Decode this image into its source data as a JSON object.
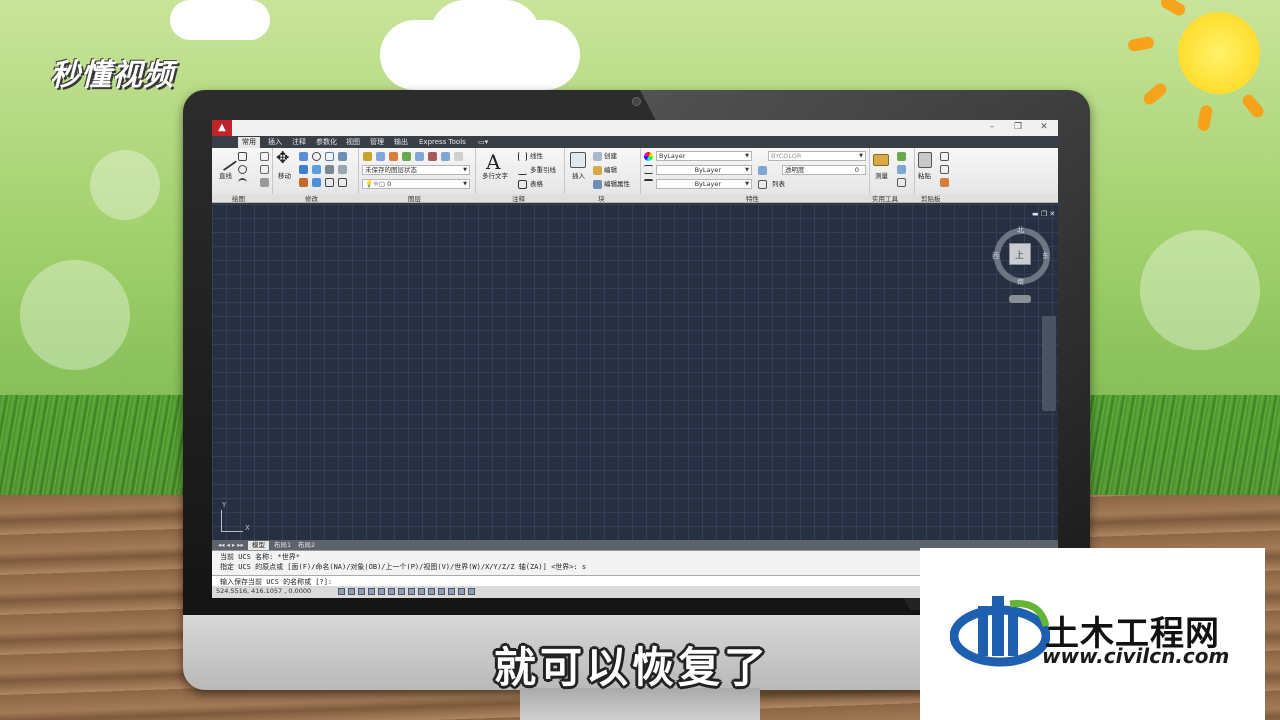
{
  "watermark_top": {
    "logo_text": "秒懂视频"
  },
  "watermark_bottom": {
    "name": "土木工程网",
    "url": "www.civilcn.com"
  },
  "subtitle": "就可以恢复了",
  "app": {
    "tabs": [
      "常用",
      "插入",
      "注释",
      "参数化",
      "视图",
      "管理",
      "输出",
      "Express Tools"
    ],
    "active_tab": "常用",
    "panels": {
      "draw": {
        "title": "绘图",
        "line_label": "直线"
      },
      "modify": {
        "title": "修改",
        "move_label": "移动"
      },
      "layers": {
        "title": "图层",
        "layer_state": "未保存的图层状态",
        "current_layer": "0"
      },
      "annotation": {
        "title": "注释",
        "mtext_label": "多行文字",
        "linear_label": "线性",
        "mleader_label": "多重引线",
        "table_label": "表格"
      },
      "block": {
        "title": "块",
        "insert_label": "插入",
        "create_label": "创建",
        "edit_label": "编辑",
        "edit_attr_label": "编辑属性"
      },
      "properties": {
        "title": "特性",
        "color": "ByLayer",
        "linetype": "ByLayer",
        "lineweight": "ByLayer",
        "plotstyle": "BYCOLOR",
        "transparency_label": "透明度",
        "transparency_value": "0",
        "list_label": "列表"
      },
      "utilities": {
        "title": "实用工具",
        "measure_label": "测量"
      },
      "clipboard": {
        "title": "剪贴板",
        "paste_label": "粘贴"
      }
    },
    "viewcube": {
      "north": "北",
      "south": "南",
      "east": "东",
      "west": "西",
      "top": "上"
    },
    "ucs_icon": {
      "x": "X",
      "y": "Y"
    },
    "layout_tabs": [
      "模型",
      "布局1",
      "布局2"
    ],
    "command": {
      "line1": "当前 UCS 名称: *世界*",
      "line2": "指定 UCS 的原点或 [面(F)/命名(NA)/对象(OB)/上一个(P)/视图(V)/世界(W)/X/Y/Z/Z 轴(ZA)] <世界>: s",
      "prompt": "输入保存当前 UCS 的名称或 [?]:"
    },
    "status": {
      "coords": "524.5516, 416.1057 , 0.0000"
    }
  }
}
